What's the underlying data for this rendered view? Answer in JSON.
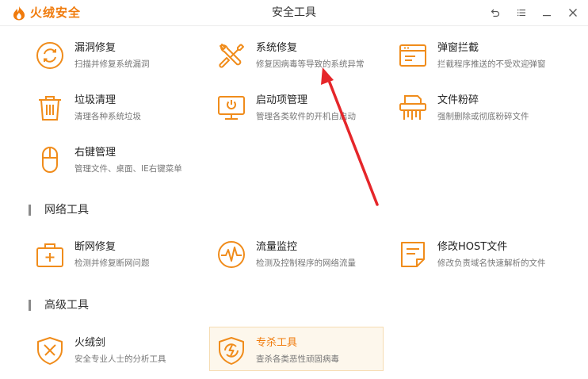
{
  "app": {
    "brand": "火绒安全",
    "window_title": "安全工具",
    "accent_color": "#f07b0c",
    "controls": [
      {
        "name": "back-icon"
      },
      {
        "name": "menu-icon"
      },
      {
        "name": "minimize-icon"
      },
      {
        "name": "close-icon"
      }
    ]
  },
  "system_tools": [
    {
      "name": "漏洞修复",
      "desc": "扫描并修复系统漏洞",
      "icon": "vulnerability-fix-icon"
    },
    {
      "name": "系统修复",
      "desc": "修复因病毒等导致的系统异常",
      "icon": "wrench-screwdriver-icon"
    },
    {
      "name": "弹窗拦截",
      "desc": "拦截程序推送的不受欢迎弹窗",
      "icon": "popup-block-icon"
    },
    {
      "name": "垃圾清理",
      "desc": "清理各种系统垃圾",
      "icon": "trash-icon"
    },
    {
      "name": "启动项管理",
      "desc": "管理各类软件的开机自启动",
      "icon": "monitor-icon"
    },
    {
      "name": "文件粉碎",
      "desc": "强制删除或彻底粉碎文件",
      "icon": "shredder-icon"
    },
    {
      "name": "右键管理",
      "desc": "管理文件、桌面、IE右键菜单",
      "icon": "mouse-icon"
    }
  ],
  "network_section": {
    "title": "网络工具"
  },
  "network_tools": [
    {
      "name": "断网修复",
      "desc": "检测并修复断网问题",
      "icon": "first-aid-icon"
    },
    {
      "name": "流量监控",
      "desc": "检测及控制程序的网络流量",
      "icon": "traffic-monitor-icon"
    },
    {
      "name": "修改HOST文件",
      "desc": "修改负责域名快速解析的文件",
      "icon": "document-icon"
    }
  ],
  "advanced_section": {
    "title": "高级工具"
  },
  "advanced_tools": [
    {
      "name": "火绒剑",
      "desc": "安全专业人士的分析工具",
      "icon": "sword-shield-icon"
    },
    {
      "name": "专杀工具",
      "desc": "查杀各类恶性顽固病毒",
      "icon": "kill-virus-shield-icon",
      "selected": true
    }
  ]
}
